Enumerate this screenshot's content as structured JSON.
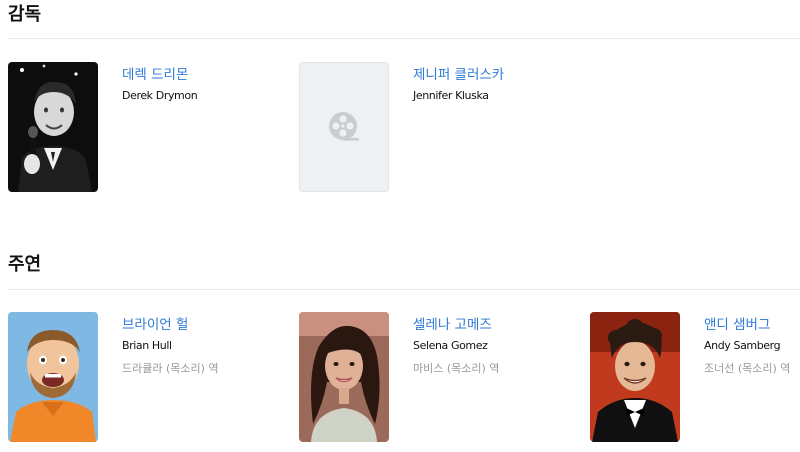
{
  "sections": {
    "director": {
      "title": "감독",
      "people": [
        {
          "name_ko": "데렉 드리몬",
          "name_en": "Derek Drymon",
          "photo": "photo"
        },
        {
          "name_ko": "제니퍼 클러스카",
          "name_en": "Jennifer Kluska",
          "photo": "film-reel-icon"
        }
      ]
    },
    "cast": {
      "title": "주연",
      "people": [
        {
          "name_ko": "브라이언 헐",
          "name_en": "Brian Hull",
          "role": "드라큘라 (목소리) 역",
          "photo": "photo"
        },
        {
          "name_ko": "셀레나 고메즈",
          "name_en": "Selena Gomez",
          "role": "마비스 (목소리) 역",
          "photo": "photo"
        },
        {
          "name_ko": "앤디 샘버그",
          "name_en": "Andy Samberg",
          "role": "조너선 (목소리) 역",
          "photo": "photo"
        }
      ]
    }
  },
  "colors": {
    "name_link": "#2f7ad6",
    "role_text": "#999999",
    "title_text": "#111111",
    "divider": "#e9e9e9"
  }
}
